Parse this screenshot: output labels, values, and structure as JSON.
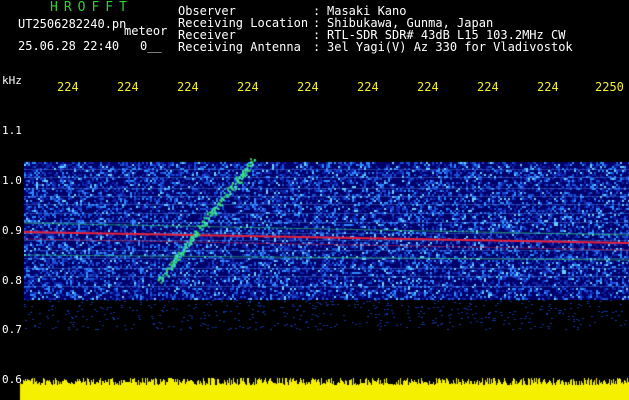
{
  "header": {
    "logo": "HROFFT",
    "file_name": "UT2506282240.pn",
    "file_suffix": "meteor",
    "date_time": "25.06.28 22:40",
    "frame_counter": "0__"
  },
  "station_info": [
    {
      "label": "Observer",
      "value": "Masaki Kano"
    },
    {
      "label": "Receiving Location",
      "value": "Shibukawa, Gunma, Japan"
    },
    {
      "label": "Receiver",
      "value": "RTL-SDR SDR# 43dB L15 103.2MHz CW"
    },
    {
      "label": "Receiving Antenna",
      "value": "3el Yagi(V) Az 330 for Vladivostok"
    }
  ],
  "axes": {
    "y_unit": "kHz",
    "y_ticks": [
      "1.1",
      "1.0",
      "0.9",
      "0.8",
      "0.7",
      "0.6"
    ],
    "x_ticks": [
      "224",
      "224",
      "224",
      "224",
      "224",
      "224",
      "224",
      "224",
      "224",
      "2250"
    ]
  },
  "colors": {
    "text_green": "#2fd12f",
    "text_white": "#ffffff",
    "text_yellow": "#f2ee2a",
    "spectrogram_background": "#00006a",
    "signal_red": "#e8203a",
    "signal_green": "#36d870",
    "level_bar": "#f5f000"
  }
}
